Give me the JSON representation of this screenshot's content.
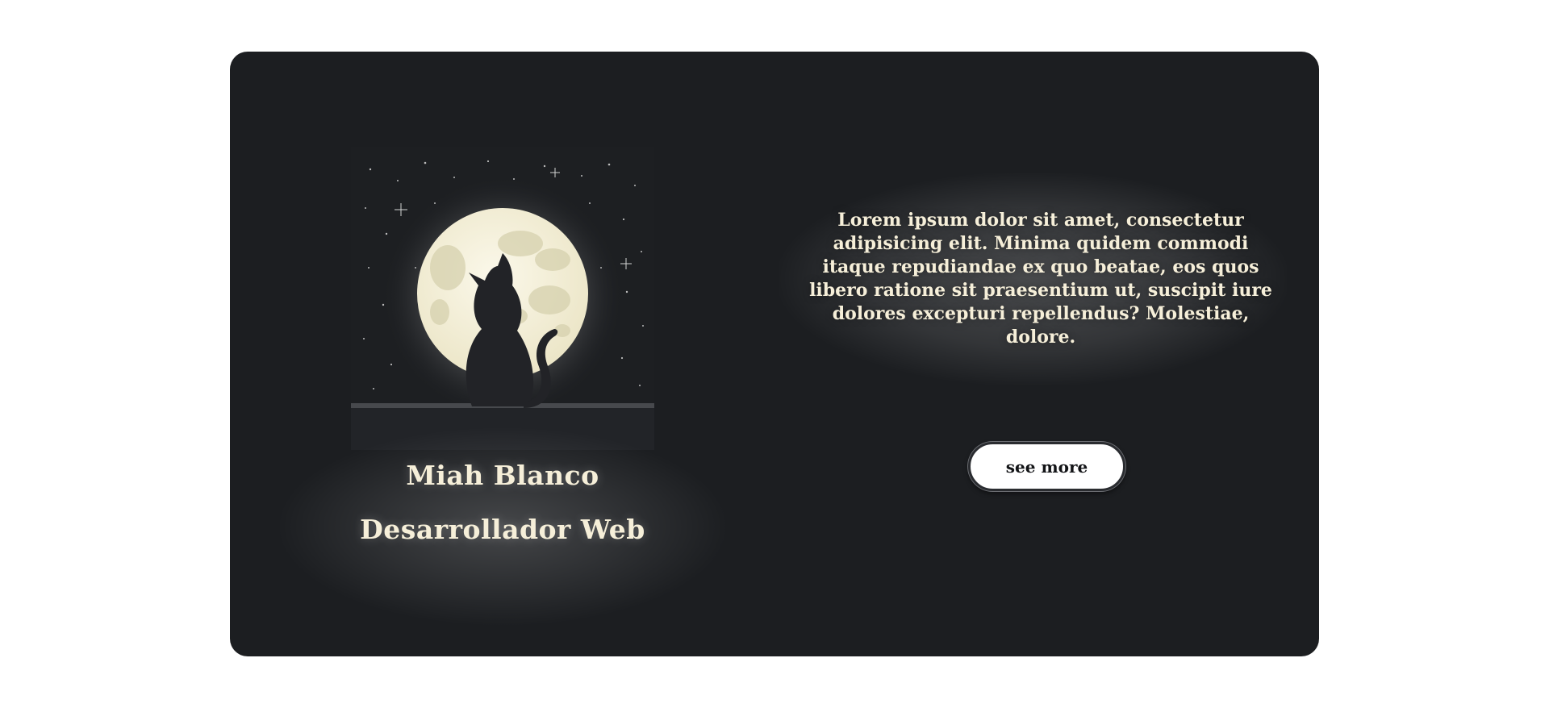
{
  "profile": {
    "name": "Miah Blanco",
    "role": "Desarrollador Web",
    "avatar_icon": "cat-moon-illustration"
  },
  "info": {
    "description": "Lorem ipsum dolor sit amet, consectetur adipisicing elit. Minima quidem commodi itaque repudiandae ex quo beatae, eos quos libero ratione sit praesentium ut, suscipit iure dolores excepturi repellendus? Molestiae, dolore.",
    "button_label": "see more"
  },
  "colors": {
    "page_background": "#ffffff",
    "card_background": "#1c1e21",
    "text": "#f6efd9",
    "moon": "#f3efd8",
    "button_background": "#ffffff"
  }
}
